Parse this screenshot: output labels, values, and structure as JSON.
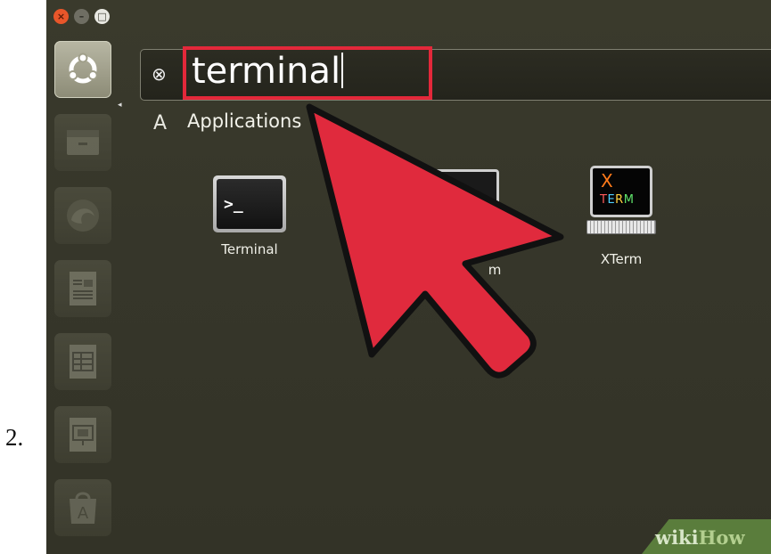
{
  "step_number": "2.",
  "window_controls": {
    "close": "×",
    "minimize": "–",
    "maximize": "□"
  },
  "launcher": {
    "items": [
      {
        "icon": "ubuntu-dash-icon"
      },
      {
        "icon": "files-icon"
      },
      {
        "icon": "firefox-icon"
      },
      {
        "icon": "writer-icon"
      },
      {
        "icon": "calc-icon"
      },
      {
        "icon": "impress-icon"
      },
      {
        "icon": "software-center-icon"
      }
    ]
  },
  "search": {
    "value": "terminal",
    "clear_icon": "⊗"
  },
  "section": {
    "icon": "A",
    "title": "Applications"
  },
  "results": [
    {
      "label": "Terminal",
      "icon": "terminal-icon"
    },
    {
      "label": "m",
      "icon": "uxterm-icon"
    },
    {
      "label": "XTerm",
      "icon": "xterm-icon",
      "icon_text_top": "X",
      "icon_text_bottom": "TERM"
    }
  ],
  "watermark": {
    "part1": "wiki",
    "part2": "How"
  },
  "colors": {
    "highlight": "#e3283a",
    "arrow": "#e02a3d",
    "background": "#363629"
  }
}
